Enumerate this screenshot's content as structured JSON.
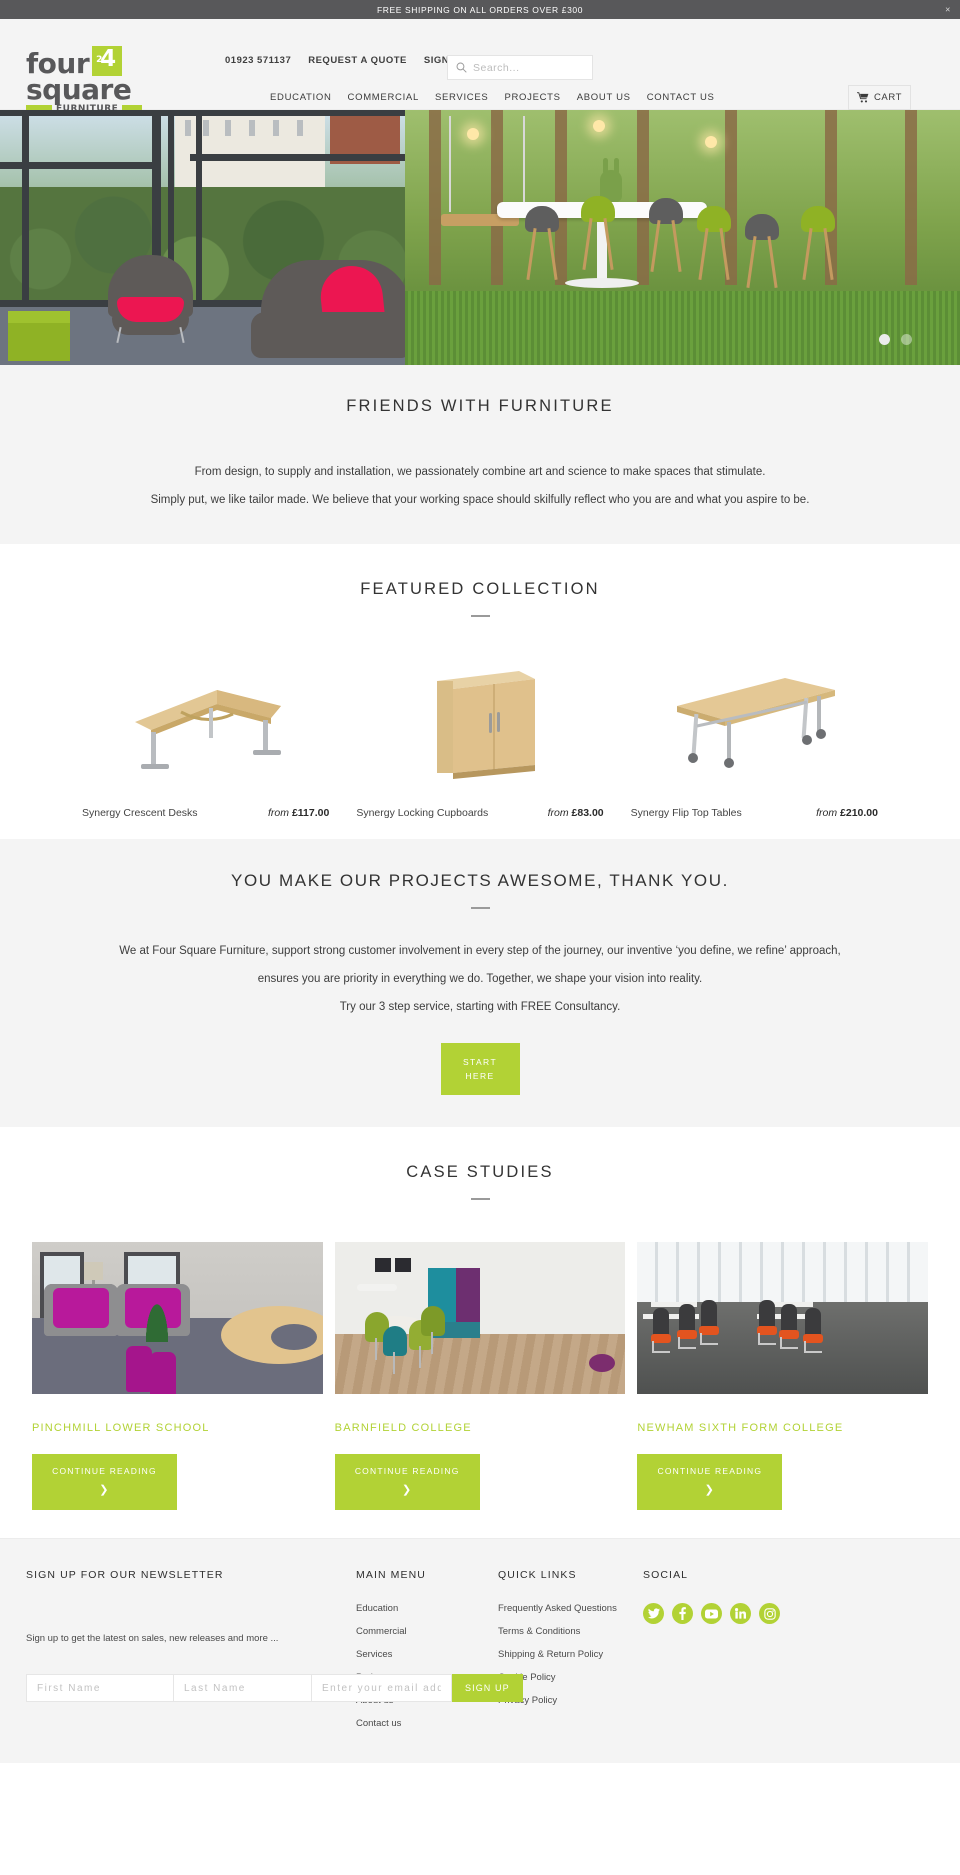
{
  "announcement": {
    "text": "FREE SHIPPING ON ALL ORDERS OVER £300",
    "close_label": "×"
  },
  "header": {
    "logo": {
      "line1": "four",
      "badge": "4",
      "badge_sup": "2",
      "line2": "square",
      "line3": "FURNITURE"
    },
    "utility": [
      {
        "label": "01923 571137",
        "name": "phone-link"
      },
      {
        "label": "REQUEST A QUOTE",
        "name": "request-quote-link"
      },
      {
        "label": "SIGN IN",
        "name": "sign-in-link"
      }
    ],
    "search": {
      "placeholder": "Search...",
      "value": ""
    },
    "nav": [
      {
        "label": "EDUCATION"
      },
      {
        "label": "COMMERCIAL"
      },
      {
        "label": "SERVICES"
      },
      {
        "label": "PROJECTS"
      },
      {
        "label": "ABOUT US"
      },
      {
        "label": "CONTACT US"
      }
    ],
    "cart_label": "CART"
  },
  "hero": {
    "slides": 2,
    "active_slide": 1
  },
  "intro": {
    "title": "FRIENDS WITH FURNITURE",
    "paragraph1": "From design, to supply and installation, we passionately combine art and science to make spaces that stimulate.",
    "paragraph2": "Simply put, we like tailor made. We believe that your working space should skilfully reflect who you are and what you aspire to be."
  },
  "featured": {
    "title": "FEATURED COLLECTION",
    "products": [
      {
        "name": "Synergy Crescent Desks",
        "price_prefix": "from",
        "price": "£117.00"
      },
      {
        "name": "Synergy Locking Cupboards",
        "price_prefix": "from",
        "price": "£83.00"
      },
      {
        "name": "Synergy Flip Top Tables",
        "price_prefix": "from",
        "price": "£210.00"
      }
    ]
  },
  "projects": {
    "title": "YOU MAKE OUR PROJECTS AWESOME, THANK YOU.",
    "paragraph1": "We at Four Square Furniture, support strong customer involvement in every step of the journey, our inventive ‘you define, we refine’ approach, ensures you are priority in everything we do. Together, we shape your vision into reality.",
    "paragraph2": "Try our 3 step service, starting with FREE Consultancy.",
    "cta_line1": "START",
    "cta_line2": "HERE"
  },
  "case_studies": {
    "title": "CASE STUDIES",
    "items": [
      {
        "title": "PINCHMILL LOWER SCHOOL",
        "cta": "CONTINUE READING",
        "chevron": "❯"
      },
      {
        "title": "BARNFIELD COLLEGE",
        "cta": "CONTINUE READING",
        "chevron": "❯"
      },
      {
        "title": "NEWHAM SIXTH FORM COLLEGE",
        "cta": "CONTINUE READING",
        "chevron": "❯"
      }
    ]
  },
  "footer": {
    "newsletter": {
      "heading": "SIGN UP FOR OUR NEWSLETTER",
      "first_name_placeholder": "First Name",
      "last_name_placeholder": "Last Name",
      "email_placeholder": "Enter your email address",
      "button_label": "SIGN UP",
      "note": "Sign up to get the latest on sales, new releases and more ..."
    },
    "main_menu": {
      "heading": "MAIN MENU",
      "links": [
        "Education",
        "Commercial",
        "Services",
        "Projects",
        "About us",
        "Contact us"
      ]
    },
    "quick_links": {
      "heading": "QUICK LINKS",
      "links": [
        "Frequently Asked Questions",
        "Terms & Conditions",
        "Shipping & Return Policy",
        "Cookie Policy",
        "Privacy Policy"
      ]
    },
    "social": {
      "heading": "SOCIAL",
      "icons": [
        "twitter-icon",
        "facebook-icon",
        "youtube-icon",
        "linkedin-icon",
        "instagram-icon"
      ]
    }
  },
  "colors": {
    "brand_green": "#b2d235",
    "announce_bar": "#58585a",
    "header_bg": "#f4f4f4",
    "text": "#3a3a3a"
  }
}
